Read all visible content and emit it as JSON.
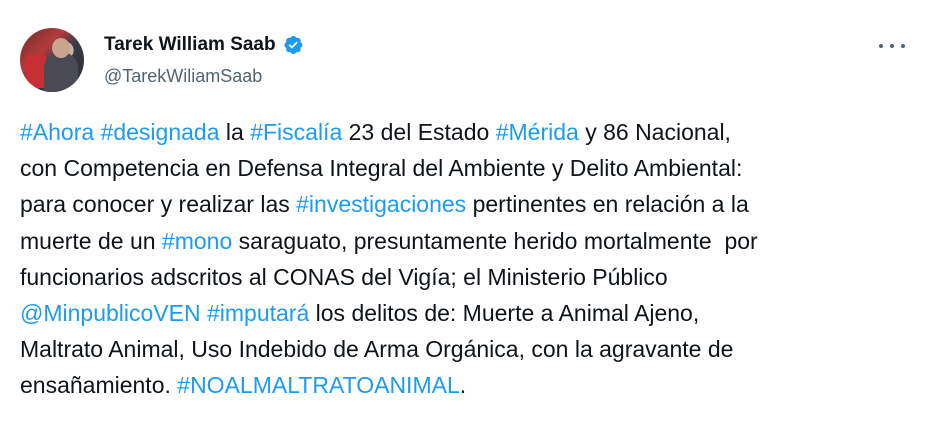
{
  "author": {
    "display_name": "Tarek William Saab",
    "handle": "@TarekWiliamSaab",
    "verified_icon": "verified-badge-icon",
    "avatar": "profile-photo"
  },
  "menu": {
    "icon": "more-horizontal-icon"
  },
  "colors": {
    "link": "#1d9bf0",
    "text": "#0f1419",
    "muted": "#536471",
    "verified": "#1d9bf0"
  },
  "tweet": {
    "lines": [
      [
        {
          "text": "#Ahora",
          "type": "hashtag"
        },
        {
          "text": " ",
          "type": "text"
        },
        {
          "text": "#designada",
          "type": "hashtag"
        },
        {
          "text": " la ",
          "type": "text"
        },
        {
          "text": "#Fiscalía",
          "type": "hashtag"
        },
        {
          "text": " 23 del Estado ",
          "type": "text"
        },
        {
          "text": "#Mérida",
          "type": "hashtag"
        },
        {
          "text": " y 86 Nacional,",
          "type": "text"
        }
      ],
      [
        {
          "text": "con Competencia en Defensa Integral del Ambiente y Delito Ambiental:",
          "type": "text"
        }
      ],
      [
        {
          "text": "para conocer y realizar las ",
          "type": "text"
        },
        {
          "text": "#investigaciones",
          "type": "hashtag"
        },
        {
          "text": " pertinentes en relación a la",
          "type": "text"
        }
      ],
      [
        {
          "text": "muerte de un ",
          "type": "text"
        },
        {
          "text": "#mono",
          "type": "hashtag"
        },
        {
          "text": " saraguato, presuntamente herido mortalmente  por",
          "type": "text"
        }
      ],
      [
        {
          "text": "funcionarios adscritos al CONAS del Vigía; el Ministerio Público",
          "type": "text"
        }
      ],
      [
        {
          "text": "@MinpublicoVEN",
          "type": "mention"
        },
        {
          "text": " ",
          "type": "text"
        },
        {
          "text": "#imputará",
          "type": "hashtag"
        },
        {
          "text": " los delitos de: Muerte a Animal Ajeno,",
          "type": "text"
        }
      ],
      [
        {
          "text": "Maltrato Animal, Uso Indebido de Arma Orgánica, con la agravante de",
          "type": "text"
        }
      ],
      [
        {
          "text": "ensañamiento. ",
          "type": "text"
        },
        {
          "text": "#NOALMALTRATOANIMAL",
          "type": "hashtag"
        },
        {
          "text": ".",
          "type": "text"
        }
      ]
    ]
  }
}
